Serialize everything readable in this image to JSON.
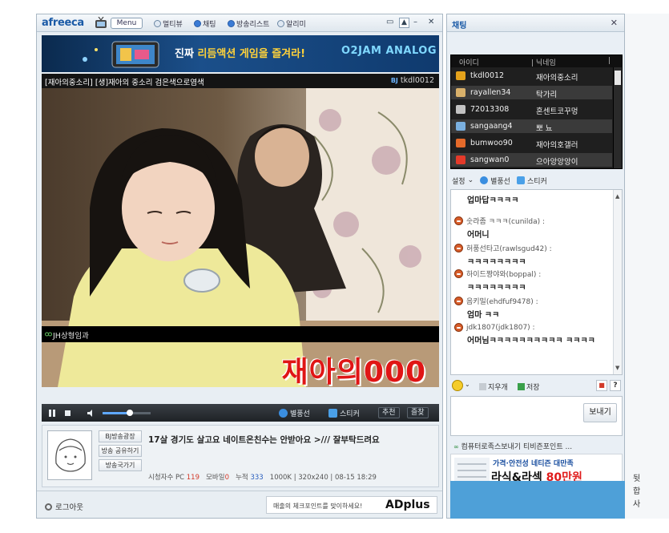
{
  "player": {
    "logo": "afreeca",
    "menu_label": "Menu",
    "toolbar_items": [
      "멀티뷰",
      "채팅",
      "방송리스트",
      "알리미"
    ],
    "banner": {
      "text_white": "진짜 ",
      "text_yellow": "리듬액션 게임을 즐겨라!",
      "brand": "O2JAM ANALOG"
    },
    "stream_title": "[재아의중소리] [생]재아의 중소리 검은색으로염색",
    "bj_label": "BJ",
    "bj_id": "tkdl0012",
    "overlay_text": "재아의000",
    "video_caption": "JH상형임과",
    "controls": {
      "star_balloon": "별풍선",
      "sticker": "스티커",
      "recommend": "추천",
      "favorite": "즐찾"
    },
    "info": {
      "side_buttons": [
        "BJ방송광장",
        "방송 공유하기",
        "방송국가기"
      ],
      "message": "17살 경기도 살고요 네이트온친수는 안받아요 >/// 잘부탁드려요",
      "stats": {
        "viewers_label": "시청자수 PC",
        "pc": "119",
        "mobile_label": "모바일",
        "mobile": "0",
        "total_label": "누적",
        "total": "333",
        "detail": "1000K | 320x240 | 08-15 18:29"
      }
    },
    "bottom": {
      "logout": "로그아웃",
      "ad_note": "매출의 체크포인트를 맞이하세요!",
      "ad_brand": "ADplus"
    }
  },
  "chat": {
    "title": "채팅",
    "columns": [
      "아이디",
      "닉네임"
    ],
    "users": [
      {
        "id": "tkdl0012",
        "nick": "재아의중소리",
        "color": "#e4a21b"
      },
      {
        "id": "rayallen34",
        "nick": "탁가리",
        "color": "#d8b06a"
      },
      {
        "id": "72013308",
        "nick": "혼센트코꾸멍",
        "color": "#c2c2c2"
      },
      {
        "id": "sangaang4",
        "nick": "뽀 뇨",
        "color": "#7ab0e0"
      },
      {
        "id": "bumwoo90",
        "nick": "재아의호갤러",
        "color": "#e46a2a"
      },
      {
        "id": "sangwan0",
        "nick": "으아앙앙앙이",
        "color": "#e43a2a"
      }
    ],
    "tools": {
      "settings": "설정",
      "star_balloon": "별풍선",
      "sticker": "스티커"
    },
    "messages": [
      {
        "name": "",
        "text": "업마답ㅋㅋㅋㅋ"
      },
      {
        "name": "숫라좀 ㅋㅋㅋ(cunilda) :",
        "text": "어머니"
      },
      {
        "name": "허풍선타고(rawlsgud42) :",
        "text": "ㅋㅋㅋㅋㅋㅋㅋㅋ"
      },
      {
        "name": "하이드짱야와(boppal) :",
        "text": "ㅋㅋㅋㅋㅋㅋㅋㅋ"
      },
      {
        "name": "음키밀(ehdfuf9478) :",
        "text": "엄마 ㅋㅋ"
      },
      {
        "name": "jdk1807(jdk1807) :",
        "text": "어머님ㅋㅋㅋㅋㅋㅋㅋㅋㅋㅋ ㅋㅋㅋㅋ"
      }
    ],
    "input_tools": {
      "clear": "지우개",
      "save": "저장"
    },
    "send_label": "보내기",
    "ad_line_prefix": "컴퓨터로족스보내기",
    "ad_line_rest": " 티비즌포인트 ...",
    "bottom_ad": {
      "line1": "가격·안전성 네티즌 대만족",
      "line2a": "라식&라섹 ",
      "line2b": "80만원"
    }
  },
  "desktop": {
    "text": "뒷\n합\n사"
  }
}
